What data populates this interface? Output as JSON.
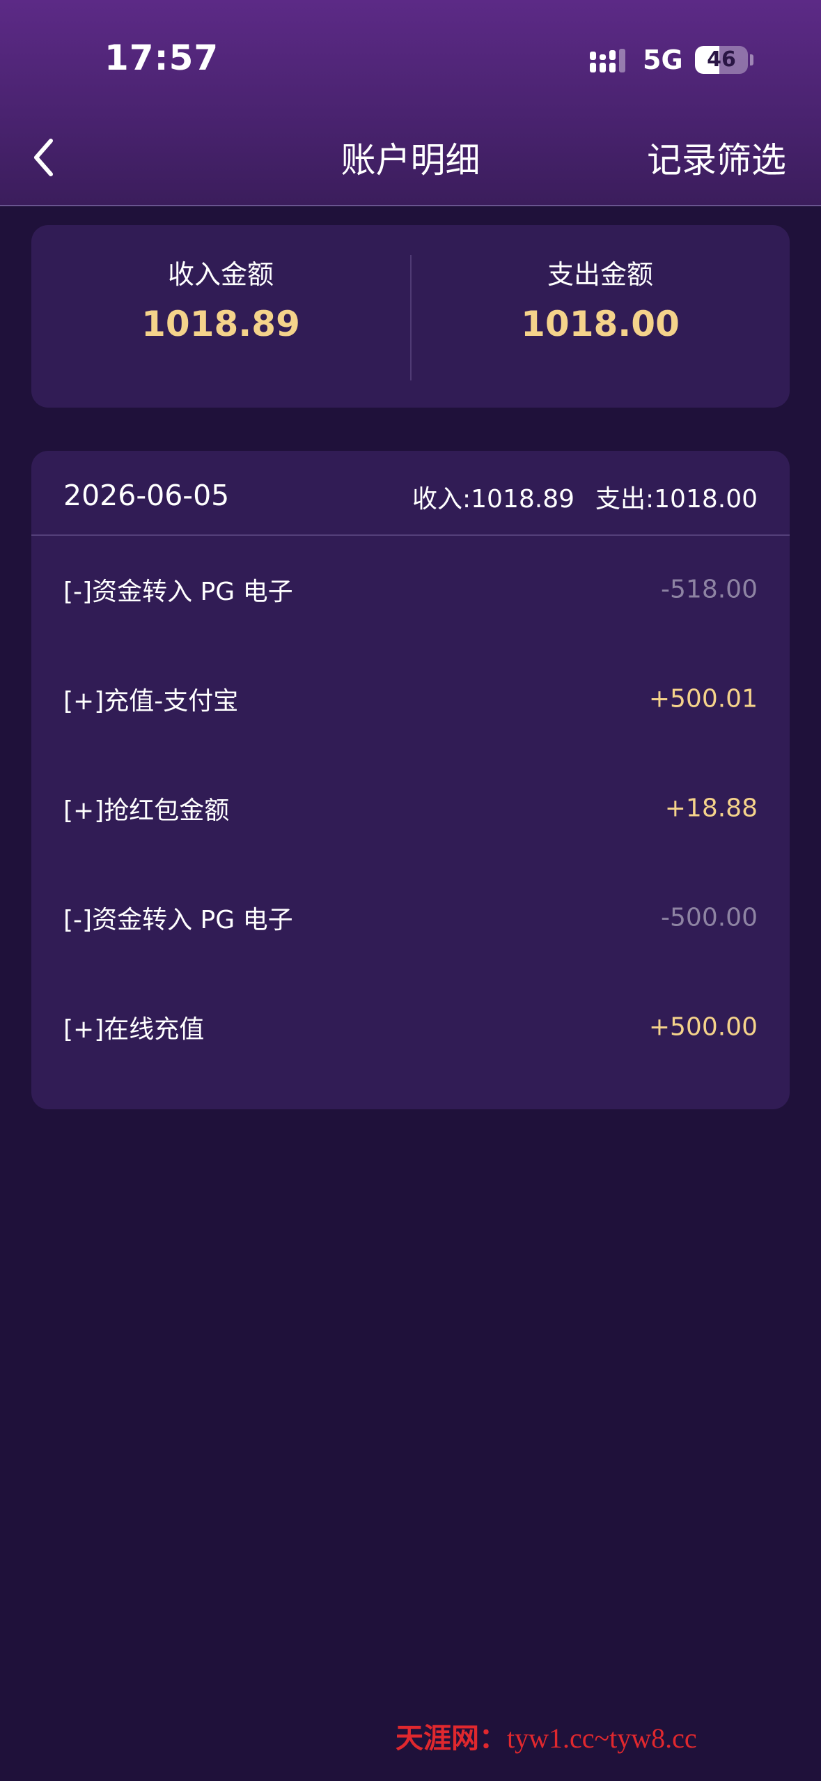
{
  "status_bar": {
    "time": "17:57",
    "network": "5G",
    "battery_level": "46"
  },
  "nav": {
    "title": "账户明细",
    "filter_label": "记录筛选",
    "back_icon": "chevron-left-icon"
  },
  "summary": {
    "income_label": "收入金额",
    "income_value": "1018.89",
    "expense_label": "支出金额",
    "expense_value": "1018.00"
  },
  "day_group": {
    "date": "2026-06-05",
    "income_total": "收入:1018.89",
    "expense_total": "支出:1018.00",
    "records": [
      {
        "label": "[-]资金转入 PG 电子",
        "amount": "-518.00",
        "type": "expense"
      },
      {
        "label": "[+]充值-支付宝",
        "amount": "+500.01",
        "type": "income"
      },
      {
        "label": "[+]抢红包金额",
        "amount": "+18.88",
        "type": "income"
      },
      {
        "label": "[-]资金转入 PG 电子",
        "amount": "-500.00",
        "type": "expense"
      },
      {
        "label": "[+]在线充值",
        "amount": "+500.00",
        "type": "income"
      }
    ]
  },
  "watermark": {
    "brand": "天涯网：",
    "url": "tyw1.cc~tyw8.cc"
  },
  "colors": {
    "background": "#1f113a",
    "card": "#311c55",
    "header_gradient_top": "#5c2a86",
    "accent_gold": "#f5d38b",
    "muted_amount": "#8e84a3",
    "watermark_red": "#e0282e"
  }
}
